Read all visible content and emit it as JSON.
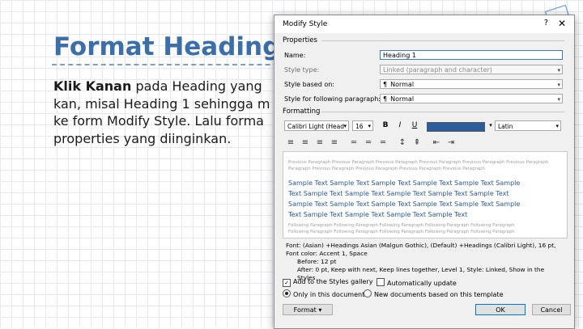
{
  "slide": {
    "title": "Format Heading St",
    "body_bold": "Klik Kanan",
    "body_line1_rest": " pada Heading yang",
    "body_line2": "kan, misal Heading 1 sehingga m",
    "body_line3": "ke form Modify Style. Lalu forma",
    "body_line4": "properties yang diinginkan."
  },
  "dialog": {
    "title": "Modify Style",
    "help_icon": "?",
    "close_icon": "✕",
    "properties_label": "Properties",
    "name_label": "Name:",
    "name_value": "Heading 1",
    "style_type_label": "Style type:",
    "style_type_value": "Linked (paragraph and character)",
    "based_on_label": "Style based on:",
    "based_on_value": "Normal",
    "following_label": "Style for following paragraph:",
    "following_value": "Normal",
    "formatting_label": "Formatting",
    "font_value": "Calibri Light (Head",
    "size_value": "16",
    "bold": "B",
    "italic": "I",
    "underline": "U",
    "color_hex": "#2c5d99",
    "script_value": "Latin",
    "preview_prev_lines": [
      "Previous Paragraph Previous Paragraph Previous Paragraph Previous Paragraph Previous Paragraph Previous Paragraph",
      "Paragraph Previous Paragraph Previous Paragraph Previous Paragraph Previous Paragraph"
    ],
    "preview_sample_lines": [
      "Sample Text Sample Text Sample Text Sample Text Sample Text Sample",
      "Text Sample Text Sample Text Sample Text Sample Text Sample Text",
      "Sample Text Sample Text Sample Text Sample Text Sample Text Sample",
      "Text Sample Text Sample Text Sample Text Sample Text"
    ],
    "preview_next_lines": [
      "Following Paragraph Following Paragraph Following Paragraph Following Paragraph Following Paragraph",
      "Following Paragraph Following Paragraph Following Paragraph Following Paragraph Following Paragraph"
    ],
    "desc_line1": "Font: (Asian) +Headings Asian (Malgun Gothic), (Default) +Headings (Calibri Light), 16 pt,",
    "desc_line2": "Font color: Accent 1, Space",
    "desc_line3": "Before:  12 pt",
    "desc_line4": "After:  0 pt, Keep with next, Keep lines together, Level 1, Style: Linked, Show in the Styles",
    "add_gallery_label": "Add to the Styles gallery",
    "auto_update_label": "Automatically update",
    "only_doc_label": "Only in this document",
    "new_docs_label": "New documents based on this template",
    "format_button": "Format ▾",
    "ok_button": "OK",
    "cancel_button": "Cancel"
  }
}
